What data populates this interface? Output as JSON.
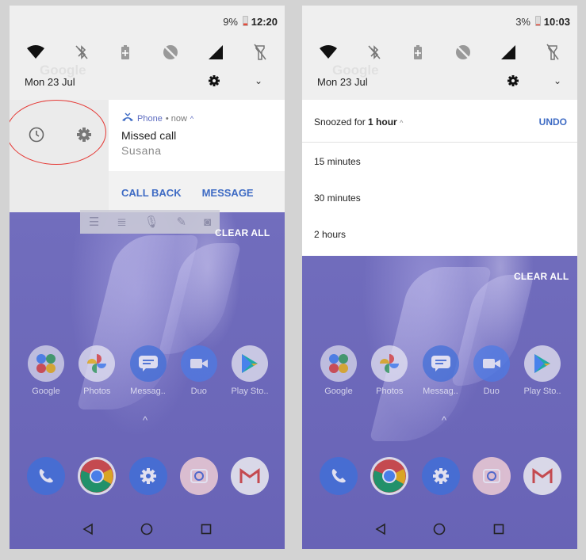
{
  "left": {
    "status": {
      "battery_pct": "9%",
      "time": "12:20"
    },
    "date": "Mon 23 Jul",
    "notification": {
      "app_name": "Phone",
      "when": "• now",
      "title": "Missed call",
      "caller": "Susana",
      "actions": [
        "CALL BACK",
        "MESSAGE"
      ]
    },
    "clear_all": "CLEAR ALL"
  },
  "right": {
    "status": {
      "battery_pct": "3%",
      "time": "10:03"
    },
    "date": "Mon 23 Jul",
    "snooze": {
      "label_prefix": "Snoozed for ",
      "label_value": "1 hour",
      "undo": "UNDO",
      "options": [
        "15 minutes",
        "30 minutes",
        "2 hours"
      ]
    },
    "clear_all": "CLEAR ALL"
  },
  "apps": [
    "Google",
    "Photos",
    "Messag..",
    "Duo",
    "Play Sto.."
  ],
  "apps_right": [
    "Google",
    "Photos",
    "Messag..",
    "Duo",
    "Play Sto.."
  ],
  "dock_icons": [
    "phone-icon",
    "chrome-icon",
    "settings-icon",
    "camera-icon",
    "gmail-icon"
  ],
  "colors": {
    "accent": "#3e6bc4",
    "highlight": "#e53935",
    "wallpaper": "#7b77c6"
  }
}
